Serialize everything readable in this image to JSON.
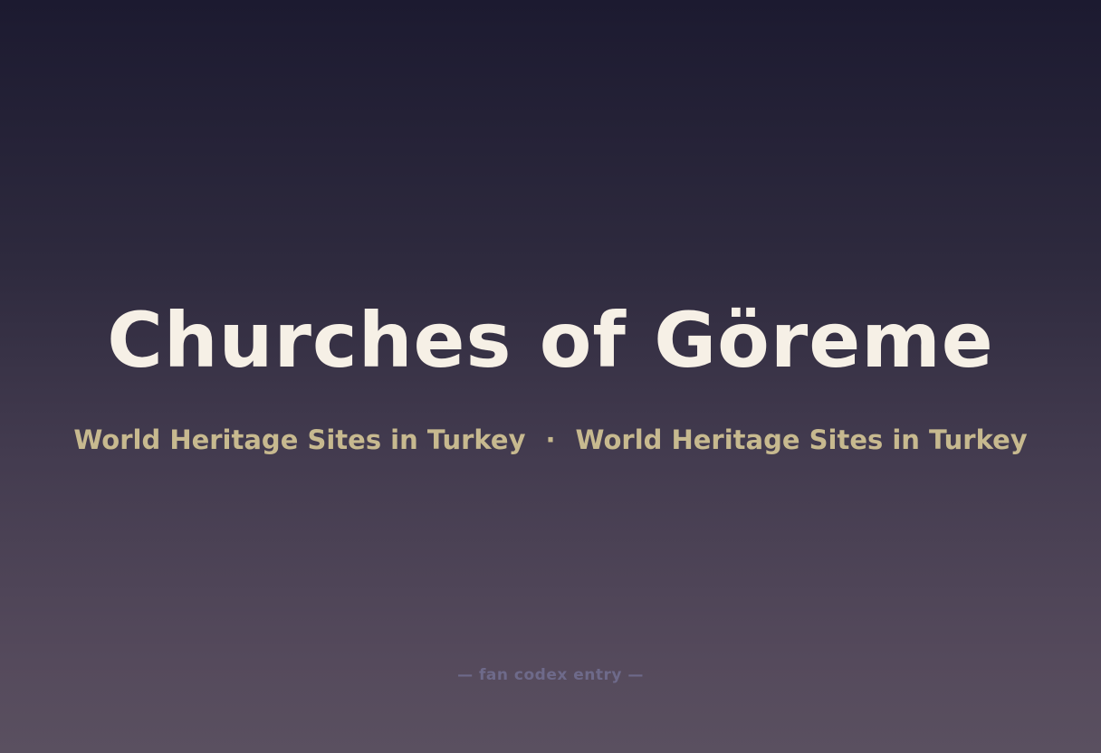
{
  "title": "Churches of Göreme",
  "subtitle": {
    "left": "World Heritage Sites in Turkey",
    "separator": "·",
    "right": "World Heritage Sites in Turkey"
  },
  "footer": "— fan codex entry —",
  "colors": {
    "title": "#f6f0e6",
    "subtitle": "#c7b98f",
    "footer": "#6e6a8a",
    "background_top": "#1c1a30",
    "background_bottom": "#5a5060"
  }
}
